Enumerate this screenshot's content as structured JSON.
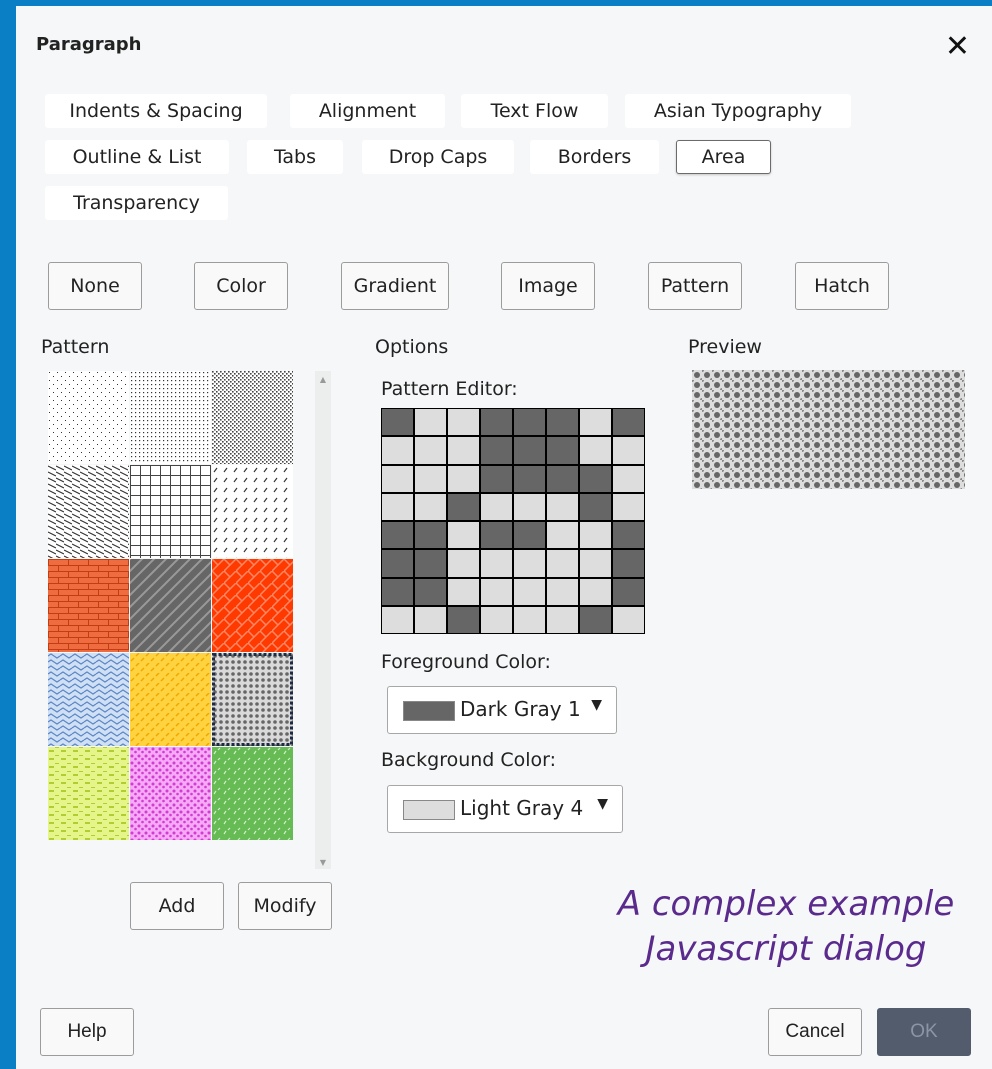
{
  "dialog": {
    "title": "Paragraph",
    "close_icon": "close-icon"
  },
  "tabs": [
    {
      "label": "Indents & Spacing",
      "active": false
    },
    {
      "label": "Alignment",
      "active": false
    },
    {
      "label": "Text Flow",
      "active": false
    },
    {
      "label": "Asian Typography",
      "active": false
    },
    {
      "label": "Outline & List",
      "active": false
    },
    {
      "label": "Tabs",
      "active": false
    },
    {
      "label": "Drop Caps",
      "active": false
    },
    {
      "label": "Borders",
      "active": false
    },
    {
      "label": "Area",
      "active": true
    },
    {
      "label": "Transparency",
      "active": false
    }
  ],
  "fill_types": [
    "None",
    "Color",
    "Gradient",
    "Image",
    "Pattern",
    "Hatch"
  ],
  "pattern_section": {
    "label": "Pattern",
    "add_label": "Add",
    "modify_label": "Modify"
  },
  "options_section": {
    "label": "Options",
    "editor_label": "Pattern Editor:",
    "grid": [
      [
        1,
        0,
        0,
        1,
        1,
        1,
        0,
        1
      ],
      [
        0,
        0,
        0,
        1,
        1,
        1,
        0,
        0
      ],
      [
        0,
        0,
        0,
        1,
        1,
        1,
        1,
        0
      ],
      [
        0,
        0,
        1,
        0,
        0,
        0,
        1,
        0
      ],
      [
        1,
        1,
        0,
        1,
        1,
        0,
        0,
        1
      ],
      [
        1,
        1,
        0,
        0,
        0,
        0,
        0,
        1
      ],
      [
        1,
        1,
        0,
        0,
        0,
        0,
        0,
        1
      ],
      [
        0,
        0,
        1,
        0,
        0,
        0,
        1,
        0
      ]
    ],
    "foreground_label": "Foreground Color:",
    "foreground_value": "Dark Gray 1",
    "foreground_color": "#666666",
    "background_label": "Background Color:",
    "background_value": "Light Gray 4",
    "background_color": "#dddddd"
  },
  "preview_section": {
    "label": "Preview"
  },
  "annotation": {
    "line1": "A complex example",
    "line2": "Javascript dialog"
  },
  "footer": {
    "help_label": "Help",
    "cancel_label": "Cancel",
    "ok_label": "OK"
  },
  "colors": {
    "window_border": "#0b7fc6",
    "dialog_bg": "#f6f7f8",
    "ok_bg": "#525c6d",
    "annotation": "#5a2a8c"
  }
}
